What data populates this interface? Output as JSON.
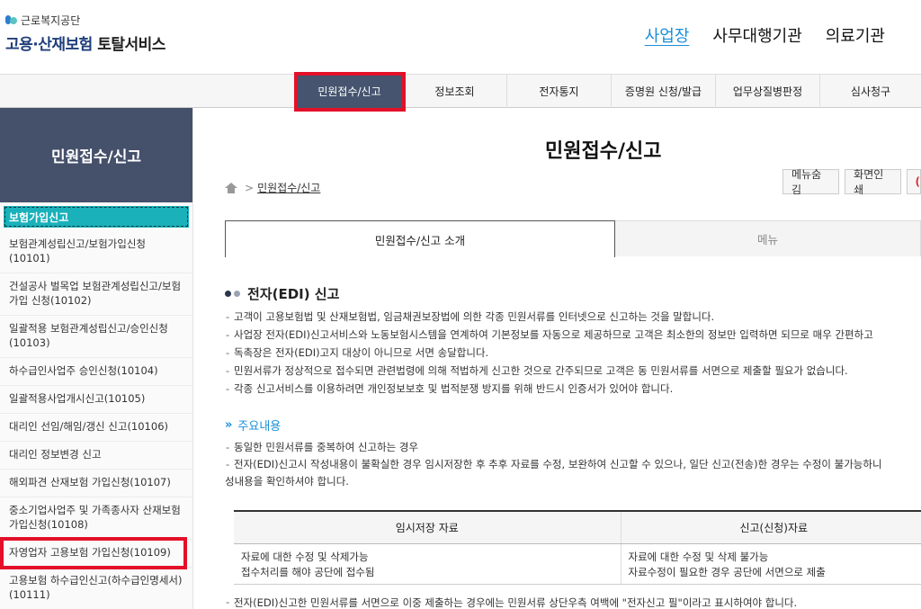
{
  "header": {
    "org_name": "근로복지공단",
    "service_title": "고용·산재보험",
    "service_suffix": "토탈서비스",
    "user_tabs": [
      "사업장",
      "사무대행기관",
      "의료기관"
    ]
  },
  "gnb": {
    "items": [
      "민원접수/신고",
      "정보조회",
      "전자통지",
      "증명원 신청/발급",
      "업무상질병판정",
      "심사청구"
    ],
    "active_index": 0
  },
  "sidebar": {
    "title": "민원접수/신고",
    "active_item": "보험가입신고",
    "items": [
      "보험관계성립신고/보험가입신청(10101)",
      "건설공사 벌목업 보험관계성립신고/보험가입 신청(10102)",
      "일괄적용 보험관계성립신고/승인신청(10103)",
      "하수급인사업주 승인신청(10104)",
      "일괄적용사업개시신고(10105)",
      "대리인 선임/해임/갱신 신고(10106)",
      "대리인 정보변경 신고",
      "해외파견 산재보험 가입신청(10107)",
      "중소기업사업주 및 가족종사자 산재보험가입신청(10108)",
      "자영업자 고용보험 가입신청(10109)",
      "고용보험 하수급인신고(하수급인명세서)(10111)"
    ]
  },
  "main": {
    "page_title": "민원접수/신고",
    "breadcrumb_sep": ">",
    "breadcrumb_current": "민원접수/신고",
    "util_buttons": [
      "메뉴숨김",
      "화면인쇄"
    ],
    "util_partial_glyph": "(",
    "tabs": [
      "민원접수/신고 소개",
      "메뉴"
    ],
    "section_title": "전자(EDI) 신고",
    "section_bullets": [
      "고객이 고용보험법 및 산재보험법, 임금채권보장법에 의한 각종 민원서류를 인터넷으로 신고하는 것을 말합니다.",
      "사업장 전자(EDI)신고서비스와 노동보험시스템을 연계하여 기본정보를 자동으로 제공하므로 고객은 최소한의 정보만 입력하면 되므로 매우 간편하고",
      "독촉장은 전자(EDI)고지 대상이 아니므로 서면 송달합니다.",
      "민원서류가 정상적으로 접수되면 관련법령에 의해 적법하게 신고한 것으로 간주되므로 고객은 동 민원서류를 서면으로 제출할 필요가 없습니다.",
      "각종 신고서비스를 이용하려면 개인정보보호 및 법적분쟁 방지를 위해 반드시 인증서가 있어야 합니다."
    ],
    "sub_title": "주요내용",
    "sub_title_arrows": "»",
    "sub_bullets": [
      "동일한 민원서류를 중복하여 신고하는 경우",
      "전자(EDI)신고시 작성내용이 불확실한 경우 임시저장한 후 추후 자료를 수정, 보완하여 신고할 수 있으나, 일단 신고(전송)한 경우는 수정이 불가능하니",
      "성내용을 확인하셔야 합니다."
    ],
    "table": {
      "headers": [
        "임시저장 자료",
        "신고(신청)자료"
      ],
      "rows": [
        [
          "자료에 대한 수정 및 삭제가능",
          "자료에 대한 수정 및 삭제 불가능"
        ],
        [
          "접수처리를 해야 공단에 접수됨",
          "자료수정이 필요한 경우 공단에 서면으로 제출"
        ]
      ]
    },
    "footnote": "전자(EDI)신고한 민원서류를 서면으로 이중 제출하는 경우에는 민원서류 상단우측 여백에 \"전자신고 필\"이라고 표시하여야 합니다."
  },
  "colors": {
    "gnb_active": "#46546f",
    "sidebar_head": "#45506b",
    "sidebar_active": "#1ab1ba",
    "accent": "#1a8fd8",
    "annotation": "#e3102a"
  }
}
